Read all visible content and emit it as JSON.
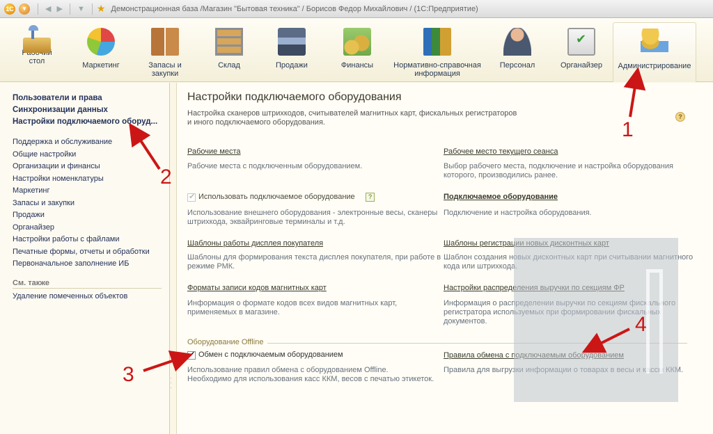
{
  "titlebar": {
    "title": "Демонстрационная база /Магазин \"Бытовая техника\" / Борисов Федор Михайлович / (1С:Предприятие)"
  },
  "toolbar": {
    "items": [
      {
        "label": "Рабочий\nстол",
        "icon": "desk-icon"
      },
      {
        "label": "Маркетинг",
        "icon": "pie-chart-icon"
      },
      {
        "label": "Запасы и\nзакупки",
        "icon": "boxes-icon"
      },
      {
        "label": "Склад",
        "icon": "warehouse-shelf-icon"
      },
      {
        "label": "Продажи",
        "icon": "cash-register-icon"
      },
      {
        "label": "Финансы",
        "icon": "coins-icon"
      },
      {
        "label": "Нормативно-справочная\nинформация",
        "icon": "books-icon"
      },
      {
        "label": "Персонал",
        "icon": "person-icon"
      },
      {
        "label": "Органайзер",
        "icon": "clipboard-icon"
      },
      {
        "label": "Администрирование",
        "icon": "admin-icon"
      }
    ]
  },
  "sidebar": {
    "top": [
      "Пользователи и права",
      "Синхронизации данных",
      "Настройки подключаемого оборуд..."
    ],
    "items": [
      "Поддержка и обслуживание",
      "Общие настройки",
      "Организации и финансы",
      "Настройки номенклатуры",
      "Маркетинг",
      "Запасы и закупки",
      "Продажи",
      "Органайзер",
      "Настройки работы с файлами",
      "Печатные формы, отчеты и обработки",
      "Первоначальное заполнение ИБ"
    ],
    "see_also_title": "См. также",
    "see_also_items": [
      "Удаление помеченных объектов"
    ]
  },
  "main": {
    "title": "Настройки подключаемого оборудования",
    "desc1": "Настройка сканеров штрихкодов, считывателей магнитных карт, фискальных регистраторов",
    "desc2": "и иного подключаемого оборудования.",
    "help": "?",
    "workplaces_link": "Рабочие места",
    "workplaces_desc": "Рабочие места с подключенным оборудованием.",
    "session_link": "Рабочее место текущего сеанса",
    "session_desc1": "Выбор рабочего места, подключение и настройка оборудования",
    "session_desc2": "которого, производились ранее.",
    "use_label": "Использовать подключаемое оборудование",
    "use_help": "?",
    "use_desc1": "Использование внешнего оборудования - электронные весы, сканеры",
    "use_desc2": "штрихкода, эквайринговые терминалы и т.д.",
    "equip_link": "Подключаемое оборудование",
    "equip_desc": "Подключение и настройка оборудования.",
    "display_link": "Шаблоны работы дисплея покупателя",
    "display_desc1": "Шаблоны для формирования текста дисплея покупателя, при работе в",
    "display_desc2": "режиме РМК.",
    "cards_link": "Шаблоны регистрации новых дисконтных карт",
    "cards_desc1": "Шаблон создания новых дисконтных карт при считывании магнитного",
    "cards_desc2": "кода или штрихкода.",
    "magnetic_link": "Форматы записи кодов магнитных карт",
    "magnetic_desc1": "Информация о формате кодов всех видов магнитных карт,",
    "magnetic_desc2": "применяемых в магазине.",
    "revenue_link": "Настройки распределения выручки по секциям ФР",
    "revenue_desc1": "Информация о распределении выручки по секциям фискального",
    "revenue_desc2": "регистратора используемых при формировании фискальных",
    "revenue_desc3": "документов.",
    "offline_title": "Оборудование Offline",
    "exchange_label": "Обмен с подключаемым оборудованием",
    "exchange_desc1": "Использование правил обмена с оборудованием Offline.",
    "exchange_desc2": "Необходимо для использования касс ККМ, весов с печатью этикеток.",
    "rules_link": "Правила обмена с подключаемым оборудованием",
    "rules_desc": "Правила для выгрузки информации о товарах в весы и кассы ККМ."
  },
  "annotations": [
    "1",
    "2",
    "3",
    "4"
  ],
  "colors": {
    "annotation": "#cc1616",
    "link": "#23325a",
    "background": "#fbf6e6"
  }
}
